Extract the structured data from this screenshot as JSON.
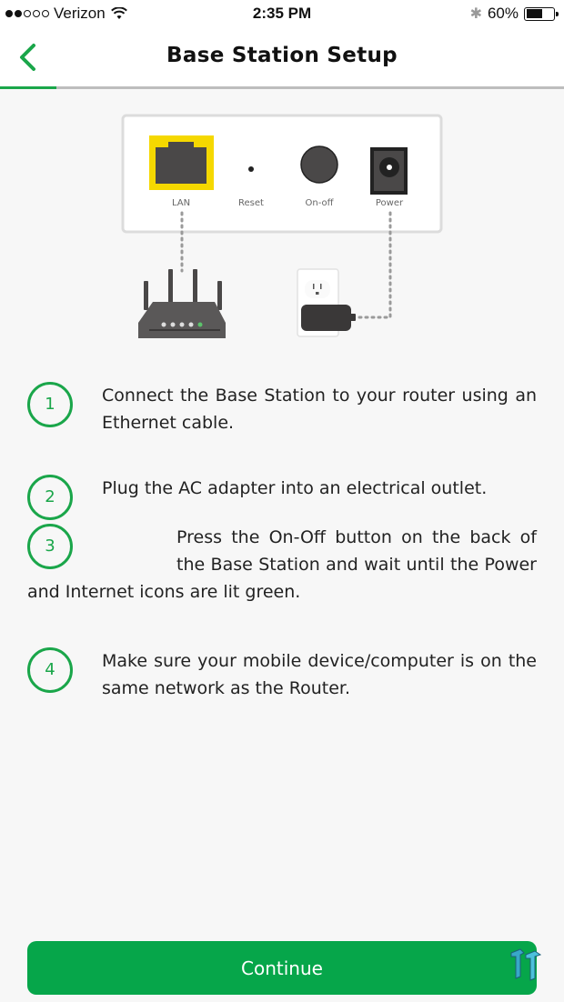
{
  "status_bar": {
    "carrier": "Verizon",
    "signal_bars_filled": 2,
    "signal_bars_total": 5,
    "time": "2:35 PM",
    "battery_percent_label": "60%",
    "battery_level": 0.6,
    "icons": [
      "signal-dots-icon",
      "wifi-icon",
      "bluetooth-icon",
      "battery-icon"
    ]
  },
  "nav": {
    "back_icon": "chevron-left-icon",
    "title": "Base Station Setup",
    "progress_fraction": 0.1
  },
  "illustration": {
    "ports": [
      {
        "name": "lan",
        "label": "LAN",
        "highlighted": true
      },
      {
        "name": "reset",
        "label": "Reset"
      },
      {
        "name": "on-off",
        "label": "On-off"
      },
      {
        "name": "power",
        "label": "Power"
      }
    ],
    "devices": [
      "router-icon",
      "power-outlet-icon",
      "ac-adapter-icon"
    ],
    "colors": {
      "highlight": "#f5d800",
      "device_dark": "#4a4848",
      "led_green": "#5cc36b"
    }
  },
  "steps": [
    {
      "number": "1",
      "text": "Connect the Base Station to your router using an Ethernet cable."
    },
    {
      "number": "2",
      "text": "Plug the AC adapter into an electrical outlet."
    },
    {
      "number": "3",
      "text": "Press the On-Off button on the back of the Base Station and wait until the Power and Internet icons are lit green."
    },
    {
      "number": "4",
      "text": "Make sure your mobile device/computer is on the same network as the Router."
    }
  ],
  "continue_button": {
    "label": "Continue"
  },
  "colors": {
    "accent": "#1aa64a",
    "button": "#06a64a",
    "background": "#f7f7f7"
  }
}
